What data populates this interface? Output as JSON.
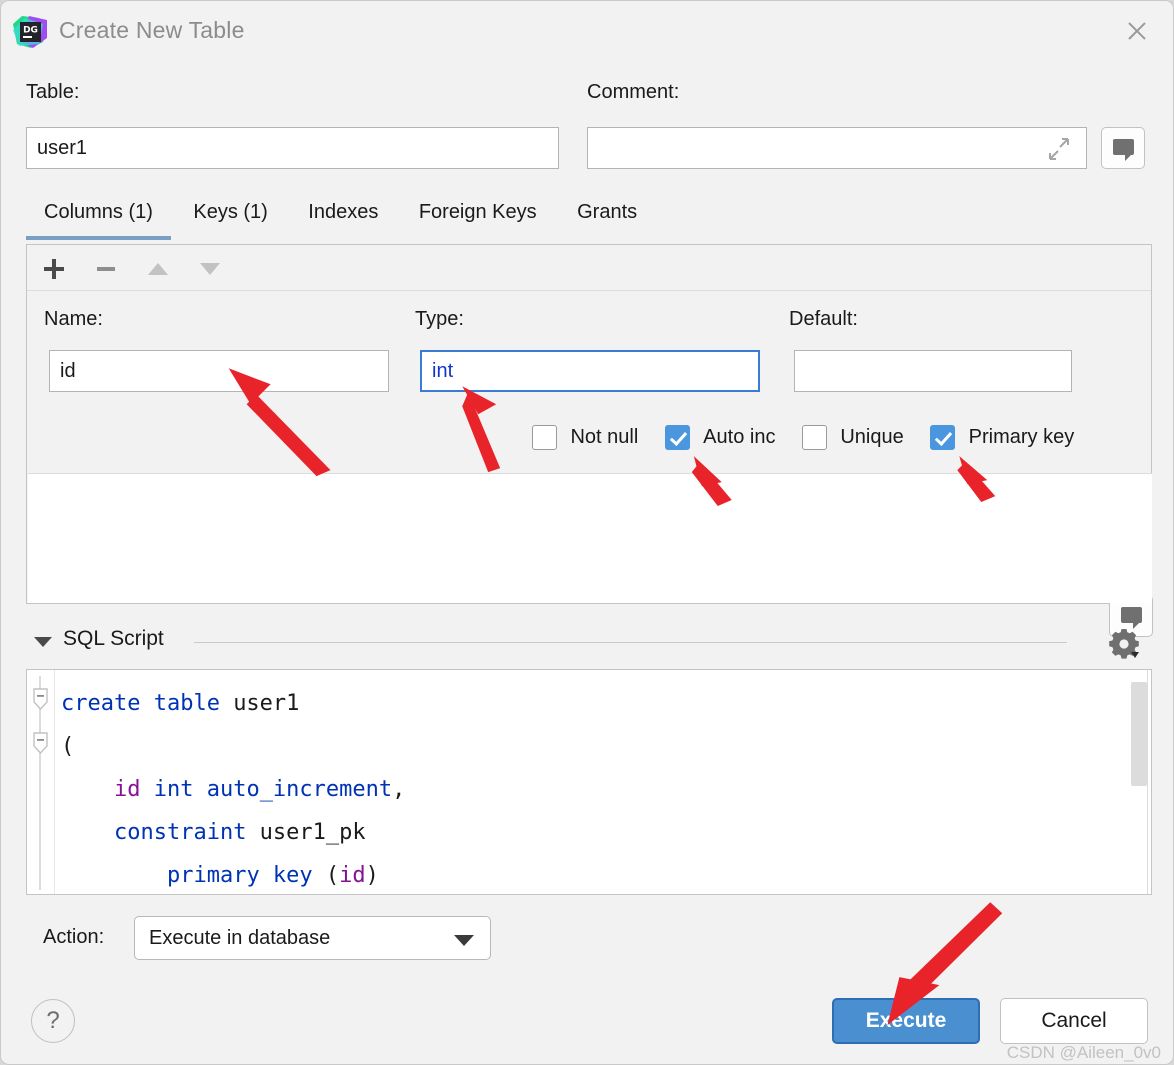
{
  "window": {
    "title": "Create New Table",
    "app_icon": "datagrip-logo",
    "close_icon": "close-icon"
  },
  "top_fields": {
    "table_label": "Table:",
    "table_value": "user1",
    "comment_label": "Comment:",
    "comment_value": "",
    "comment_placeholder": "",
    "expand_icon": "expand-icon",
    "comment_button_icon": "comment-bubble-icon"
  },
  "tabs": [
    {
      "label": "Columns (1)",
      "active": true
    },
    {
      "label": "Keys (1)",
      "active": false
    },
    {
      "label": "Indexes",
      "active": false
    },
    {
      "label": "Foreign Keys",
      "active": false
    },
    {
      "label": "Grants",
      "active": false
    }
  ],
  "toolbar": {
    "add_icon": "plus-icon",
    "remove_icon": "minus-icon",
    "move_up_icon": "arrow-up-icon",
    "move_down_icon": "arrow-down-icon"
  },
  "column_editor": {
    "name_label": "Name:",
    "name_value": "id",
    "type_label": "Type:",
    "type_value": "int",
    "default_label": "Default:",
    "default_value": "",
    "default_button_icon": "comment-bubble-icon",
    "checkboxes": [
      {
        "label": "Not null",
        "checked": false
      },
      {
        "label": "Auto inc",
        "checked": true
      },
      {
        "label": "Unique",
        "checked": false
      },
      {
        "label": "Primary key",
        "checked": true
      }
    ]
  },
  "sql_section": {
    "title": "SQL Script",
    "collapse_icon": "caret-down-icon",
    "settings_icon": "gear-icon",
    "script_lines": [
      [
        {
          "t": "create table ",
          "c": "kw"
        },
        {
          "t": "user1",
          "c": "plain"
        }
      ],
      [
        {
          "t": "(",
          "c": "plain"
        }
      ],
      [
        {
          "t": "    ",
          "c": "plain"
        },
        {
          "t": "id",
          "c": "idn"
        },
        {
          "t": " int auto_increment",
          "c": "kw"
        },
        {
          "t": ",",
          "c": "plain"
        }
      ],
      [
        {
          "t": "    ",
          "c": "plain"
        },
        {
          "t": "constraint",
          "c": "kw"
        },
        {
          "t": " user1_pk",
          "c": "plain"
        }
      ],
      [
        {
          "t": "        ",
          "c": "plain"
        },
        {
          "t": "primary key ",
          "c": "kw"
        },
        {
          "t": "(",
          "c": "plain"
        },
        {
          "t": "id",
          "c": "idn"
        },
        {
          "t": ")",
          "c": "plain"
        }
      ]
    ]
  },
  "action_row": {
    "label": "Action:",
    "selected": "Execute in database",
    "caret_icon": "chevron-down-icon"
  },
  "buttons": {
    "help": "?",
    "execute": "Execute",
    "cancel": "Cancel"
  },
  "watermark": "CSDN @Aileen_0v0",
  "colors": {
    "accent": "#4a8fd0",
    "checkbox_checked": "#4a97e0",
    "tab_underline": "#7b9fc4",
    "keyword": "#0033b3",
    "identifier": "#871094",
    "annotation_arrow": "#e8232a",
    "dialog_bg": "#f2f2f2"
  }
}
